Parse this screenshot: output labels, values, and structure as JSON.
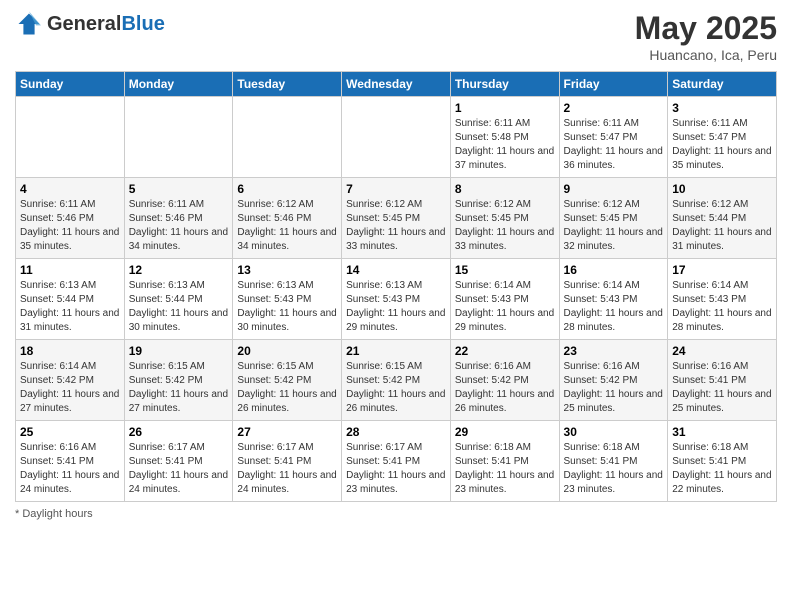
{
  "header": {
    "logo_general": "General",
    "logo_blue": "Blue",
    "month_title": "May 2025",
    "subtitle": "Huancano, Ica, Peru"
  },
  "days_of_week": [
    "Sunday",
    "Monday",
    "Tuesday",
    "Wednesday",
    "Thursday",
    "Friday",
    "Saturday"
  ],
  "footer": {
    "note": "Daylight hours"
  },
  "weeks": [
    [
      {
        "day": "",
        "sunrise": "",
        "sunset": "",
        "daylight": ""
      },
      {
        "day": "",
        "sunrise": "",
        "sunset": "",
        "daylight": ""
      },
      {
        "day": "",
        "sunrise": "",
        "sunset": "",
        "daylight": ""
      },
      {
        "day": "",
        "sunrise": "",
        "sunset": "",
        "daylight": ""
      },
      {
        "day": "1",
        "sunrise": "Sunrise: 6:11 AM",
        "sunset": "Sunset: 5:48 PM",
        "daylight": "Daylight: 11 hours and 37 minutes."
      },
      {
        "day": "2",
        "sunrise": "Sunrise: 6:11 AM",
        "sunset": "Sunset: 5:47 PM",
        "daylight": "Daylight: 11 hours and 36 minutes."
      },
      {
        "day": "3",
        "sunrise": "Sunrise: 6:11 AM",
        "sunset": "Sunset: 5:47 PM",
        "daylight": "Daylight: 11 hours and 35 minutes."
      }
    ],
    [
      {
        "day": "4",
        "sunrise": "Sunrise: 6:11 AM",
        "sunset": "Sunset: 5:46 PM",
        "daylight": "Daylight: 11 hours and 35 minutes."
      },
      {
        "day": "5",
        "sunrise": "Sunrise: 6:11 AM",
        "sunset": "Sunset: 5:46 PM",
        "daylight": "Daylight: 11 hours and 34 minutes."
      },
      {
        "day": "6",
        "sunrise": "Sunrise: 6:12 AM",
        "sunset": "Sunset: 5:46 PM",
        "daylight": "Daylight: 11 hours and 34 minutes."
      },
      {
        "day": "7",
        "sunrise": "Sunrise: 6:12 AM",
        "sunset": "Sunset: 5:45 PM",
        "daylight": "Daylight: 11 hours and 33 minutes."
      },
      {
        "day": "8",
        "sunrise": "Sunrise: 6:12 AM",
        "sunset": "Sunset: 5:45 PM",
        "daylight": "Daylight: 11 hours and 33 minutes."
      },
      {
        "day": "9",
        "sunrise": "Sunrise: 6:12 AM",
        "sunset": "Sunset: 5:45 PM",
        "daylight": "Daylight: 11 hours and 32 minutes."
      },
      {
        "day": "10",
        "sunrise": "Sunrise: 6:12 AM",
        "sunset": "Sunset: 5:44 PM",
        "daylight": "Daylight: 11 hours and 31 minutes."
      }
    ],
    [
      {
        "day": "11",
        "sunrise": "Sunrise: 6:13 AM",
        "sunset": "Sunset: 5:44 PM",
        "daylight": "Daylight: 11 hours and 31 minutes."
      },
      {
        "day": "12",
        "sunrise": "Sunrise: 6:13 AM",
        "sunset": "Sunset: 5:44 PM",
        "daylight": "Daylight: 11 hours and 30 minutes."
      },
      {
        "day": "13",
        "sunrise": "Sunrise: 6:13 AM",
        "sunset": "Sunset: 5:43 PM",
        "daylight": "Daylight: 11 hours and 30 minutes."
      },
      {
        "day": "14",
        "sunrise": "Sunrise: 6:13 AM",
        "sunset": "Sunset: 5:43 PM",
        "daylight": "Daylight: 11 hours and 29 minutes."
      },
      {
        "day": "15",
        "sunrise": "Sunrise: 6:14 AM",
        "sunset": "Sunset: 5:43 PM",
        "daylight": "Daylight: 11 hours and 29 minutes."
      },
      {
        "day": "16",
        "sunrise": "Sunrise: 6:14 AM",
        "sunset": "Sunset: 5:43 PM",
        "daylight": "Daylight: 11 hours and 28 minutes."
      },
      {
        "day": "17",
        "sunrise": "Sunrise: 6:14 AM",
        "sunset": "Sunset: 5:43 PM",
        "daylight": "Daylight: 11 hours and 28 minutes."
      }
    ],
    [
      {
        "day": "18",
        "sunrise": "Sunrise: 6:14 AM",
        "sunset": "Sunset: 5:42 PM",
        "daylight": "Daylight: 11 hours and 27 minutes."
      },
      {
        "day": "19",
        "sunrise": "Sunrise: 6:15 AM",
        "sunset": "Sunset: 5:42 PM",
        "daylight": "Daylight: 11 hours and 27 minutes."
      },
      {
        "day": "20",
        "sunrise": "Sunrise: 6:15 AM",
        "sunset": "Sunset: 5:42 PM",
        "daylight": "Daylight: 11 hours and 26 minutes."
      },
      {
        "day": "21",
        "sunrise": "Sunrise: 6:15 AM",
        "sunset": "Sunset: 5:42 PM",
        "daylight": "Daylight: 11 hours and 26 minutes."
      },
      {
        "day": "22",
        "sunrise": "Sunrise: 6:16 AM",
        "sunset": "Sunset: 5:42 PM",
        "daylight": "Daylight: 11 hours and 26 minutes."
      },
      {
        "day": "23",
        "sunrise": "Sunrise: 6:16 AM",
        "sunset": "Sunset: 5:42 PM",
        "daylight": "Daylight: 11 hours and 25 minutes."
      },
      {
        "day": "24",
        "sunrise": "Sunrise: 6:16 AM",
        "sunset": "Sunset: 5:41 PM",
        "daylight": "Daylight: 11 hours and 25 minutes."
      }
    ],
    [
      {
        "day": "25",
        "sunrise": "Sunrise: 6:16 AM",
        "sunset": "Sunset: 5:41 PM",
        "daylight": "Daylight: 11 hours and 24 minutes."
      },
      {
        "day": "26",
        "sunrise": "Sunrise: 6:17 AM",
        "sunset": "Sunset: 5:41 PM",
        "daylight": "Daylight: 11 hours and 24 minutes."
      },
      {
        "day": "27",
        "sunrise": "Sunrise: 6:17 AM",
        "sunset": "Sunset: 5:41 PM",
        "daylight": "Daylight: 11 hours and 24 minutes."
      },
      {
        "day": "28",
        "sunrise": "Sunrise: 6:17 AM",
        "sunset": "Sunset: 5:41 PM",
        "daylight": "Daylight: 11 hours and 23 minutes."
      },
      {
        "day": "29",
        "sunrise": "Sunrise: 6:18 AM",
        "sunset": "Sunset: 5:41 PM",
        "daylight": "Daylight: 11 hours and 23 minutes."
      },
      {
        "day": "30",
        "sunrise": "Sunrise: 6:18 AM",
        "sunset": "Sunset: 5:41 PM",
        "daylight": "Daylight: 11 hours and 23 minutes."
      },
      {
        "day": "31",
        "sunrise": "Sunrise: 6:18 AM",
        "sunset": "Sunset: 5:41 PM",
        "daylight": "Daylight: 11 hours and 22 minutes."
      }
    ]
  ]
}
